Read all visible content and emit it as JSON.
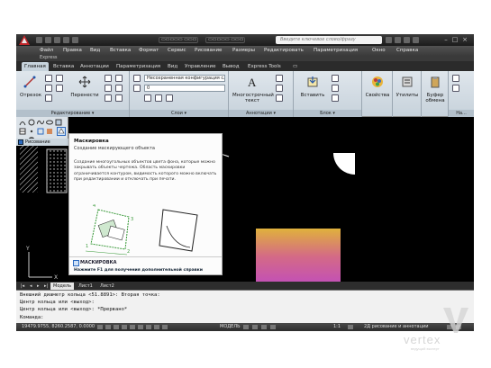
{
  "titlebar": {
    "pill1": "▭▭▭▭▭ ▭▭▭",
    "pill2": "▭▭▭▭▭ ▭▭▭",
    "search_placeholder": "Введите ключевое слово/фразу"
  },
  "menu": {
    "items": [
      "Файл",
      "Правка",
      "Вид",
      "Вставка",
      "Формат",
      "Сервис",
      "Рисование",
      "Размеры",
      "Редактировать",
      "Параметризация",
      "Окно",
      "Справка"
    ],
    "express": "Express"
  },
  "tabs": [
    "Главная",
    "Вставка",
    "Аннотации",
    "Параметризация",
    "Вид",
    "Управление",
    "Вывод",
    "Express Tools"
  ],
  "ribbon": {
    "move_label": "Перенести",
    "polyline_label": "Отрезок",
    "layer_combo": "Несохраненная конфигурация сл",
    "layer_value": "0",
    "mtext_label": "Многострочный текст",
    "insert_label": "Вставить",
    "properties_label": "Свойства",
    "utilities_label": "Утилиты",
    "clipboard_label": "Буфер обмена",
    "panel_modify": "Редактирование ▾",
    "panel_layers": "Слои ▾",
    "panel_annotations": "Аннотации ▾",
    "panel_block": "Блок ▾",
    "panel_na": "На..."
  },
  "left_palette": {
    "draw_label": "Рисование"
  },
  "tooltip": {
    "title": "Маскировка",
    "subtitle": "Создание маскирующего объекта",
    "description": "Создание многоугольных объектов цвета фона, которые можно закрывать объекты чертежа. Область маскировки ограничивается контуром, видимость которого можно включать при редактировании и отключать при печати.",
    "command": "МАСКИРОВКА",
    "help": "Нажмите F1 для получения дополнительной справки"
  },
  "layout_tabs": [
    "Модель",
    "Лист1",
    "Лист2"
  ],
  "command_lines": [
    "Внешний диаметр кольца <51.8891>:  Вторая точка:",
    "Центр кольца или <выход>:",
    "Центр кольца или <выход>: *Прервано*",
    "Команда:"
  ],
  "status": {
    "coordinates": "19479.9755, 8260.2587, 0.0000",
    "model": "МОДЕЛЬ",
    "scale": "1:1",
    "annotation": "2Д рисование и аннотации"
  },
  "watermark": {
    "text": "vertex",
    "sub": "ведущий эксперт"
  },
  "colors": {
    "accent_blue": "#2d6bc0",
    "gradient_top": "#e0b13c",
    "gradient_bottom": "#c24fb8"
  }
}
